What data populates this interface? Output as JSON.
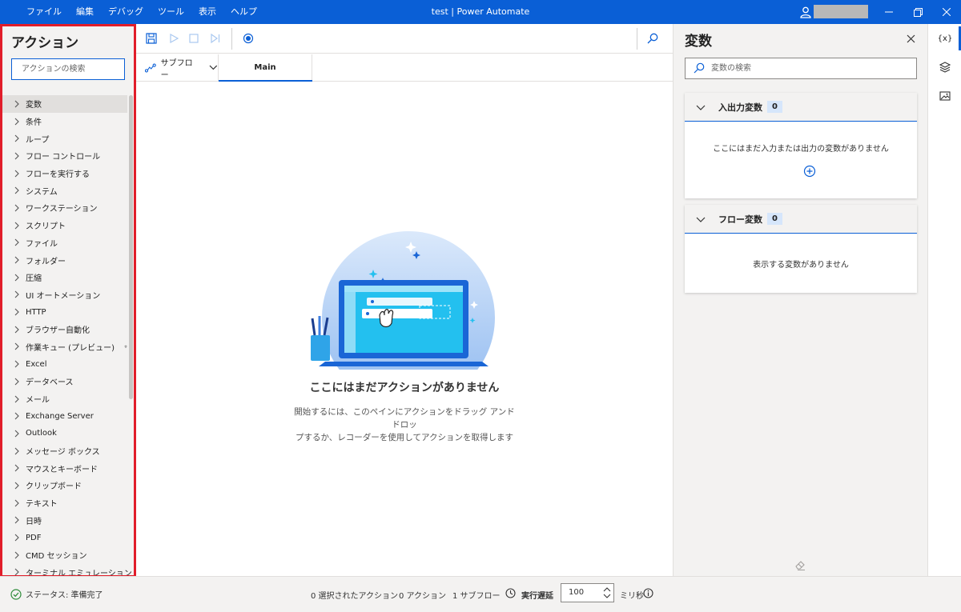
{
  "titlebar": {
    "menu": [
      "ファイル",
      "編集",
      "デバッグ",
      "ツール",
      "表示",
      "ヘルプ"
    ],
    "title": "test | Power Automate"
  },
  "actions_pane": {
    "title": "アクション",
    "search_placeholder": "アクションの検索",
    "items": [
      "変数",
      "条件",
      "ループ",
      "フロー コントロール",
      "フローを実行する",
      "システム",
      "ワークステーション",
      "スクリプト",
      "ファイル",
      "フォルダー",
      "圧縮",
      "UI オートメーション",
      "HTTP",
      "ブラウザー自動化",
      "作業キュー (プレビュー)",
      "Excel",
      "データベース",
      "メール",
      "Exchange Server",
      "Outlook",
      "メッセージ ボックス",
      "マウスとキーボード",
      "クリップボード",
      "テキスト",
      "日時",
      "PDF",
      "CMD セッション",
      "ターミナル エミュレーション"
    ]
  },
  "designer": {
    "subflow_label": "サブフロー",
    "main_tab": "Main",
    "empty_title": "ここにはまだアクションがありません",
    "empty_desc_line1": "開始するには、このペインにアクションをドラッグ アンド ドロッ",
    "empty_desc_line2": "プするか、レコーダーを使用してアクションを取得します"
  },
  "variables_pane": {
    "title": "変数",
    "search_placeholder": "変数の検索",
    "io_section": {
      "label": "入出力変数",
      "count": "0",
      "empty": "ここにはまだ入力または出力の変数がありません"
    },
    "flow_section": {
      "label": "フロー変数",
      "count": "0",
      "empty": "表示する変数がありません"
    }
  },
  "rail": {
    "variables_label": "{x}"
  },
  "statusbar": {
    "status": "ステータス: 準備完了",
    "selected_actions": "0 選択されたアクション",
    "actions": "0 アクション",
    "subflows": "1 サブフロー",
    "delay_label": "実行遅延",
    "delay_value": "100",
    "delay_unit": "ミリ秒"
  },
  "colors": {
    "accent": "#0a5fd6",
    "highlight_border": "#e11d2a",
    "pane_bg": "#f3f2f1"
  }
}
